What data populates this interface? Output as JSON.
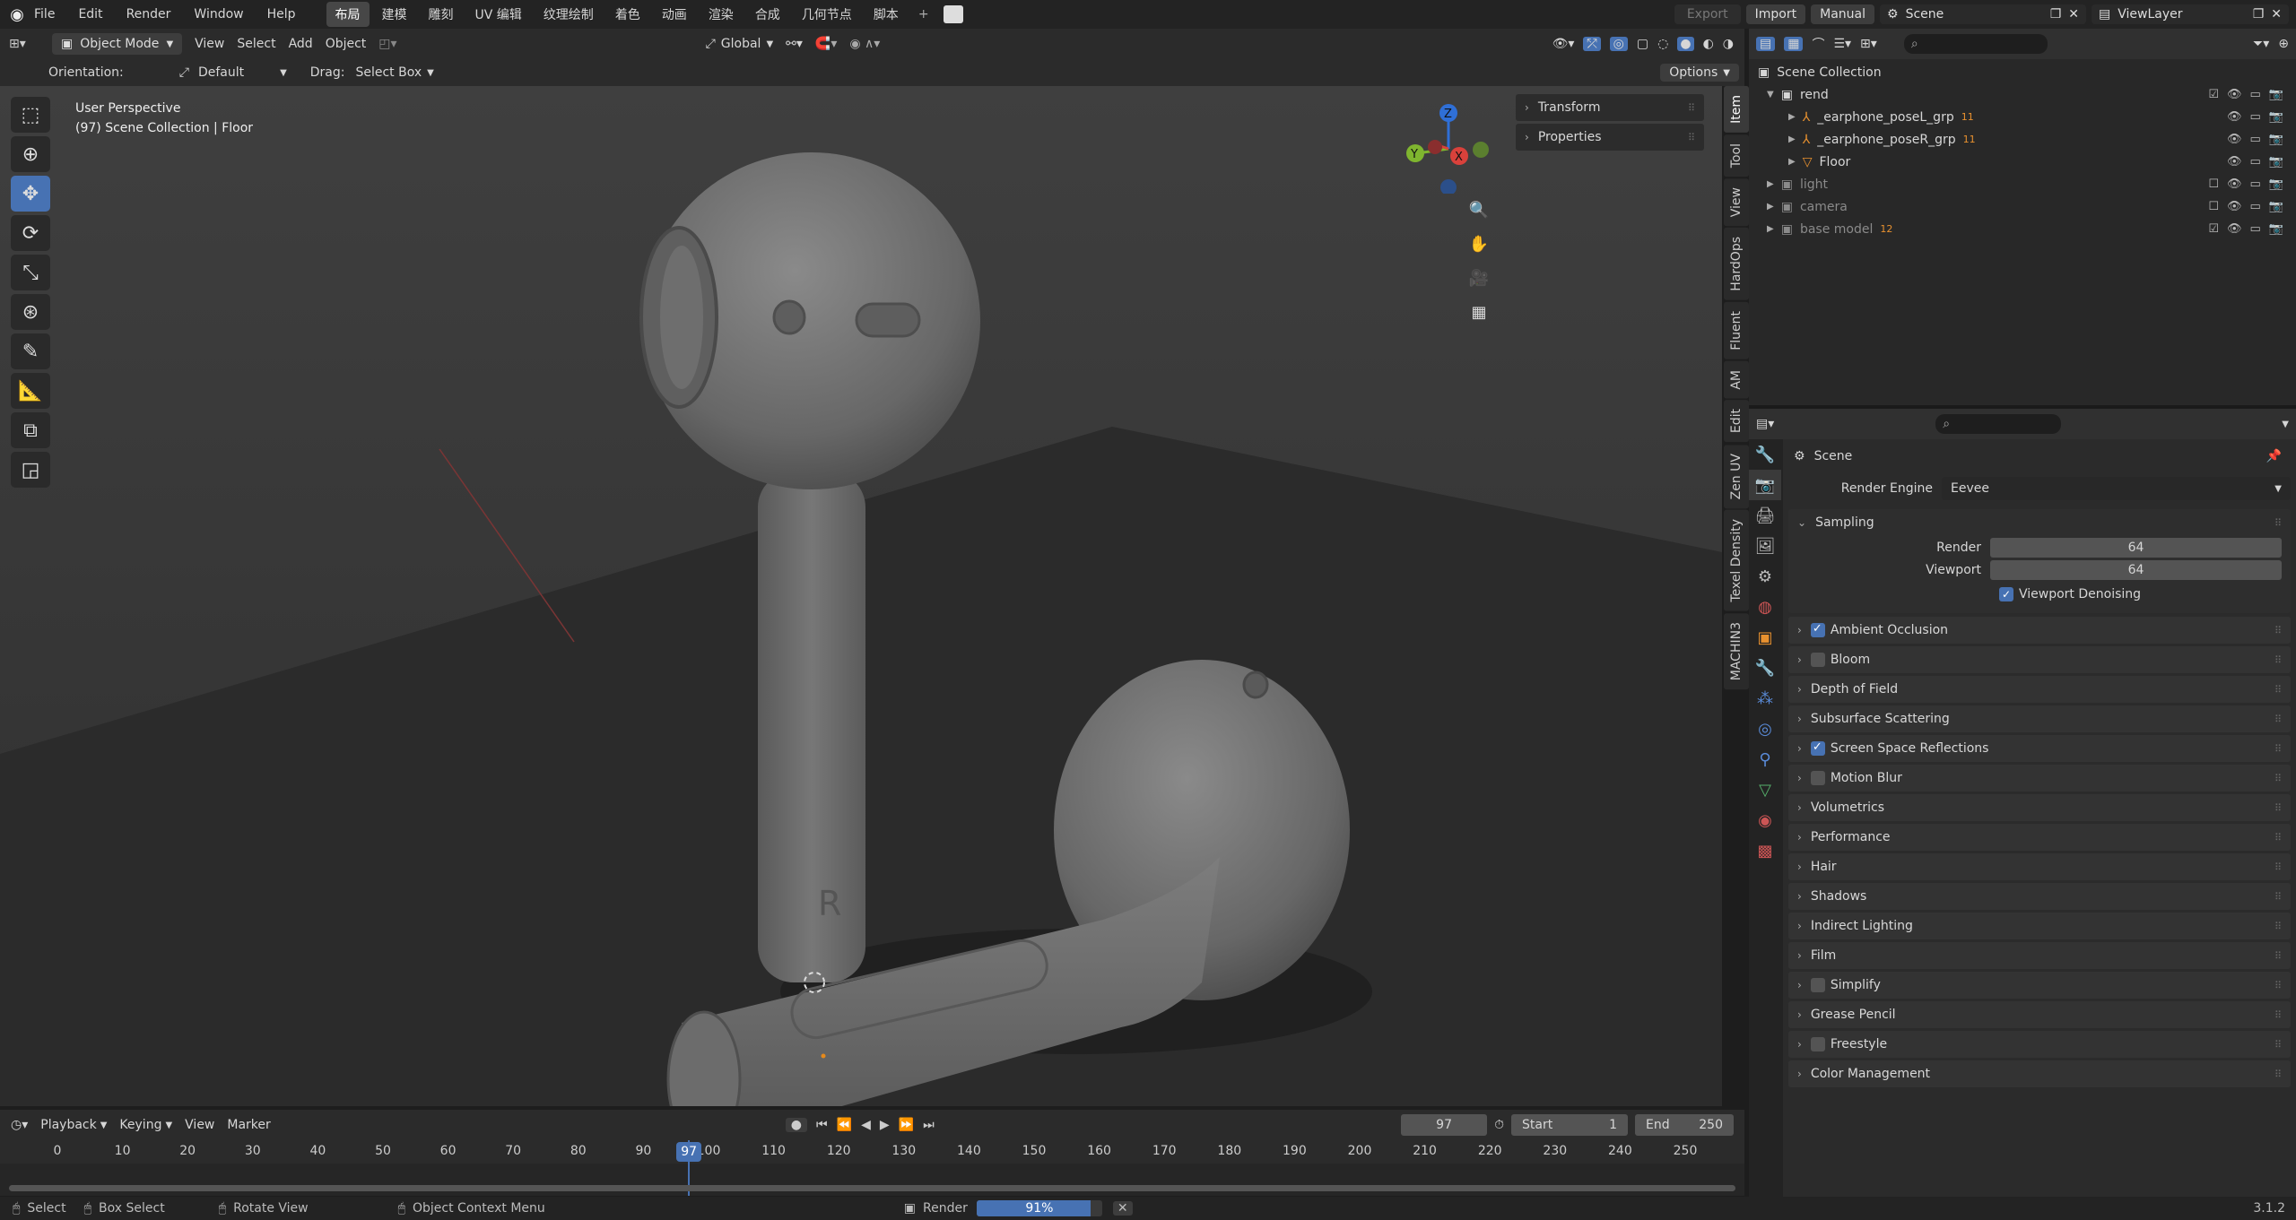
{
  "topbar": {
    "menus": [
      "File",
      "Edit",
      "Render",
      "Window",
      "Help"
    ],
    "workspaces": [
      "布局",
      "建模",
      "雕刻",
      "UV 编辑",
      "纹理绘制",
      "着色",
      "动画",
      "渲染",
      "合成",
      "几何节点",
      "脚本"
    ],
    "active_workspace": "布局",
    "export_label": "Export",
    "import_label": "Import",
    "manual_label": "Manual",
    "scene_name": "Scene",
    "view_layer": "ViewLayer"
  },
  "viewport_header": {
    "mode": "Object Mode",
    "menus": [
      "View",
      "Select",
      "Add",
      "Object"
    ],
    "transform_orientation": "Global",
    "orientation_label": "Orientation:",
    "orientation_value": "Default",
    "drag_label": "Drag:",
    "drag_value": "Select Box",
    "options_label": "Options"
  },
  "viewport": {
    "perspective_label": "User Perspective",
    "collection_label": "(97) Scene Collection | Floor",
    "gizmo_axes": [
      "Z",
      "Y",
      "X"
    ],
    "earbud_mark": "R"
  },
  "npanel": {
    "sections": [
      "Transform",
      "Properties"
    ],
    "tabs": [
      "Item",
      "Tool",
      "View",
      "HardOps",
      "Fluent",
      "AM",
      "Edit",
      "Zen UV",
      "Texel Density",
      "MACHIN3"
    ]
  },
  "outliner": {
    "root": "Scene Collection",
    "items": [
      {
        "name": "rend",
        "level": 0,
        "dim": false,
        "badge": ""
      },
      {
        "name": "_earphone_poseL_grp",
        "level": 1,
        "dim": false,
        "badge": "11"
      },
      {
        "name": "_earphone_poseR_grp",
        "level": 1,
        "dim": false,
        "badge": "11"
      },
      {
        "name": "Floor",
        "level": 1,
        "dim": false,
        "badge": ""
      },
      {
        "name": "light",
        "level": 0,
        "dim": true,
        "badge": ""
      },
      {
        "name": "camera",
        "level": 0,
        "dim": true,
        "badge": ""
      },
      {
        "name": "base model",
        "level": 0,
        "dim": true,
        "badge": "12"
      }
    ]
  },
  "properties": {
    "context": "Scene",
    "render_engine_label": "Render Engine",
    "render_engine": "Eevee",
    "sampling_title": "Sampling",
    "render_label": "Render",
    "render_samples": "64",
    "viewport_label": "Viewport",
    "viewport_samples": "64",
    "viewport_denoising": "Viewport Denoising",
    "panels": [
      {
        "label": "Ambient Occlusion",
        "checkbox": true,
        "checked": true
      },
      {
        "label": "Bloom",
        "checkbox": true,
        "checked": false
      },
      {
        "label": "Depth of Field",
        "checkbox": false,
        "checked": false
      },
      {
        "label": "Subsurface Scattering",
        "checkbox": false,
        "checked": false
      },
      {
        "label": "Screen Space Reflections",
        "checkbox": true,
        "checked": true
      },
      {
        "label": "Motion Blur",
        "checkbox": true,
        "checked": false
      },
      {
        "label": "Volumetrics",
        "checkbox": false,
        "checked": false
      },
      {
        "label": "Performance",
        "checkbox": false,
        "checked": false
      },
      {
        "label": "Hair",
        "checkbox": false,
        "checked": false
      },
      {
        "label": "Shadows",
        "checkbox": false,
        "checked": false
      },
      {
        "label": "Indirect Lighting",
        "checkbox": false,
        "checked": false
      },
      {
        "label": "Film",
        "checkbox": false,
        "checked": false
      },
      {
        "label": "Simplify",
        "checkbox": true,
        "checked": false
      },
      {
        "label": "Grease Pencil",
        "checkbox": false,
        "checked": false
      },
      {
        "label": "Freestyle",
        "checkbox": true,
        "checked": false
      },
      {
        "label": "Color Management",
        "checkbox": false,
        "checked": false
      }
    ]
  },
  "timeline": {
    "menus": [
      "Playback",
      "Keying",
      "View",
      "Marker"
    ],
    "current_frame": "97",
    "start_label": "Start",
    "start_value": "1",
    "end_label": "End",
    "end_value": "250",
    "ticks": [
      "0",
      "10",
      "20",
      "30",
      "40",
      "50",
      "60",
      "70",
      "80",
      "90",
      "100",
      "110",
      "120",
      "130",
      "140",
      "150",
      "160",
      "170",
      "180",
      "190",
      "200",
      "210",
      "220",
      "230",
      "240",
      "250"
    ]
  },
  "statusbar": {
    "select": "Select",
    "box_select": "Box Select",
    "rotate_view": "Rotate View",
    "context_menu": "Object Context Menu",
    "render_label": "Render",
    "render_progress_text": "91%",
    "render_progress": 0.91,
    "version": "3.1.2"
  },
  "colors": {
    "accent": "#4772b3",
    "x_axis": "#d9413b",
    "y_axis": "#7fb52f",
    "z_axis": "#2f6fd6"
  }
}
